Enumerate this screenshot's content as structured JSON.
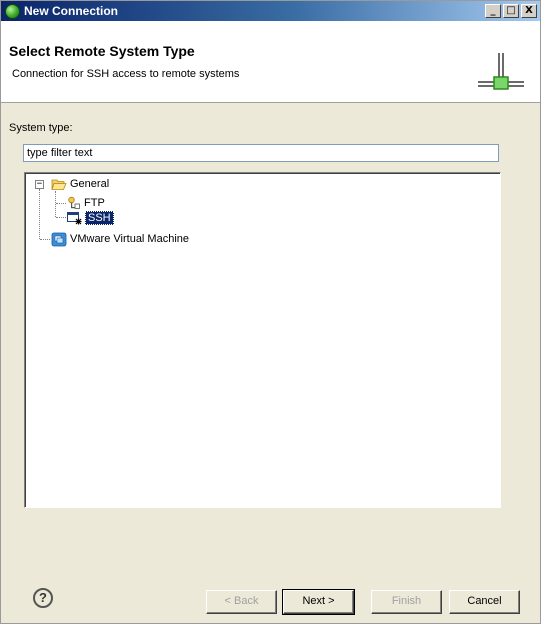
{
  "window": {
    "title": "New Connection",
    "controls": [
      "_",
      "□",
      "X"
    ]
  },
  "banner": {
    "title": "Select Remote System Type",
    "description": "Connection for SSH access to remote systems"
  },
  "form": {
    "system_type_label": "System type:",
    "filter_value": "type filter text"
  },
  "tree": {
    "items": [
      {
        "label": "General",
        "expander": "−"
      },
      {
        "label": "FTP"
      },
      {
        "label": "SSH",
        "selected": true
      },
      {
        "label": "VMware Virtual Machine"
      }
    ]
  },
  "footer": {
    "help": "?",
    "back_label": "< Back",
    "next_label": "Next >",
    "finish_label": "Finish",
    "cancel_label": "Cancel"
  },
  "colors": {
    "title_bar": "#0a246a",
    "selection": "#0a246a",
    "dialog_bg": "#ece9d8"
  }
}
